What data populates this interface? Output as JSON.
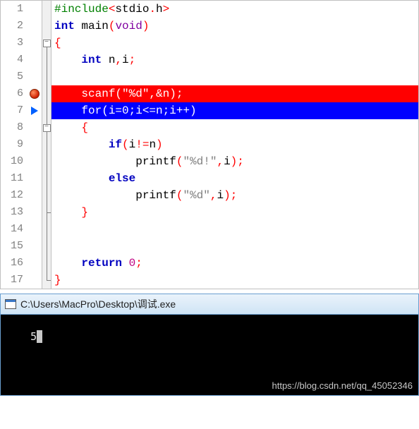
{
  "editor": {
    "lines": [
      {
        "num": 1,
        "marker": null,
        "fold": {
          "line": "none"
        },
        "hl": null,
        "tokens": [
          [
            "pre",
            "#include"
          ],
          [
            "punct",
            "<"
          ],
          [
            "var",
            "stdio"
          ],
          [
            "punct",
            "."
          ],
          [
            "var",
            "h"
          ],
          [
            "punct",
            ">"
          ]
        ],
        "indent": ""
      },
      {
        "num": 2,
        "marker": null,
        "fold": {
          "line": "none"
        },
        "hl": null,
        "tokens": [
          [
            "kw",
            "int"
          ],
          [
            "var",
            " main"
          ],
          [
            "punct",
            "("
          ],
          [
            "type",
            "void"
          ],
          [
            "punct",
            ")"
          ]
        ],
        "indent": ""
      },
      {
        "num": 3,
        "marker": null,
        "fold": {
          "box": true,
          "line": "bottom"
        },
        "hl": null,
        "tokens": [
          [
            "punct",
            "{"
          ]
        ],
        "indent": ""
      },
      {
        "num": 4,
        "marker": null,
        "fold": {
          "line": "full"
        },
        "hl": null,
        "tokens": [
          [
            "kw",
            "int"
          ],
          [
            "var",
            " n"
          ],
          [
            "punct",
            ","
          ],
          [
            "var",
            "i"
          ],
          [
            "punct",
            ";"
          ]
        ],
        "indent": "    "
      },
      {
        "num": 5,
        "marker": null,
        "fold": {
          "line": "full"
        },
        "hl": null,
        "tokens": [],
        "indent": ""
      },
      {
        "num": 6,
        "marker": "bp",
        "fold": {
          "line": "full"
        },
        "hl": "red",
        "tokens": [
          [
            "plain",
            "scanf(\"%d\",&n);"
          ]
        ],
        "indent": "    "
      },
      {
        "num": 7,
        "marker": "cur",
        "fold": {
          "line": "full"
        },
        "hl": "blue",
        "tokens": [
          [
            "plain",
            "for(i=0;i<=n;i++)"
          ]
        ],
        "indent": "    "
      },
      {
        "num": 8,
        "marker": null,
        "fold": {
          "box": true,
          "line": "full"
        },
        "hl": null,
        "tokens": [
          [
            "punct",
            "{"
          ]
        ],
        "indent": "    "
      },
      {
        "num": 9,
        "marker": null,
        "fold": {
          "line": "full"
        },
        "hl": null,
        "tokens": [
          [
            "kw",
            "if"
          ],
          [
            "punct",
            "("
          ],
          [
            "var",
            "i"
          ],
          [
            "punct",
            "!="
          ],
          [
            "var",
            "n"
          ],
          [
            "punct",
            ")"
          ]
        ],
        "indent": "        "
      },
      {
        "num": 10,
        "marker": null,
        "fold": {
          "line": "full"
        },
        "hl": null,
        "tokens": [
          [
            "var",
            "printf"
          ],
          [
            "punct",
            "("
          ],
          [
            "str",
            "\"%d!\""
          ],
          [
            "punct",
            ","
          ],
          [
            "var",
            "i"
          ],
          [
            "punct",
            ");"
          ]
        ],
        "indent": "            "
      },
      {
        "num": 11,
        "marker": null,
        "fold": {
          "line": "full"
        },
        "hl": null,
        "tokens": [
          [
            "kw",
            "else"
          ]
        ],
        "indent": "        "
      },
      {
        "num": 12,
        "marker": null,
        "fold": {
          "line": "full"
        },
        "hl": null,
        "tokens": [
          [
            "var",
            "printf"
          ],
          [
            "punct",
            "("
          ],
          [
            "str",
            "\"%d\""
          ],
          [
            "punct",
            ","
          ],
          [
            "var",
            "i"
          ],
          [
            "punct",
            ");"
          ]
        ],
        "indent": "            "
      },
      {
        "num": 13,
        "marker": null,
        "fold": {
          "line": "full",
          "end": true
        },
        "hl": null,
        "tokens": [
          [
            "punct",
            "}"
          ]
        ],
        "indent": "    "
      },
      {
        "num": 14,
        "marker": null,
        "fold": {
          "line": "full"
        },
        "hl": null,
        "tokens": [],
        "indent": ""
      },
      {
        "num": 15,
        "marker": null,
        "fold": {
          "line": "full"
        },
        "hl": null,
        "tokens": [],
        "indent": ""
      },
      {
        "num": 16,
        "marker": null,
        "fold": {
          "line": "full"
        },
        "hl": null,
        "tokens": [
          [
            "kw",
            "return"
          ],
          [
            "var",
            " "
          ],
          [
            "num",
            "0"
          ],
          [
            "punct",
            ";"
          ]
        ],
        "indent": "    "
      },
      {
        "num": 17,
        "marker": null,
        "fold": {
          "line": "top",
          "end": true
        },
        "hl": null,
        "tokens": [
          [
            "punct",
            "}"
          ]
        ],
        "indent": ""
      }
    ]
  },
  "console": {
    "title": "C:\\Users\\MacPro\\Desktop\\调试.exe",
    "output": "5",
    "watermark": "https://blog.csdn.net/qq_45052346"
  }
}
